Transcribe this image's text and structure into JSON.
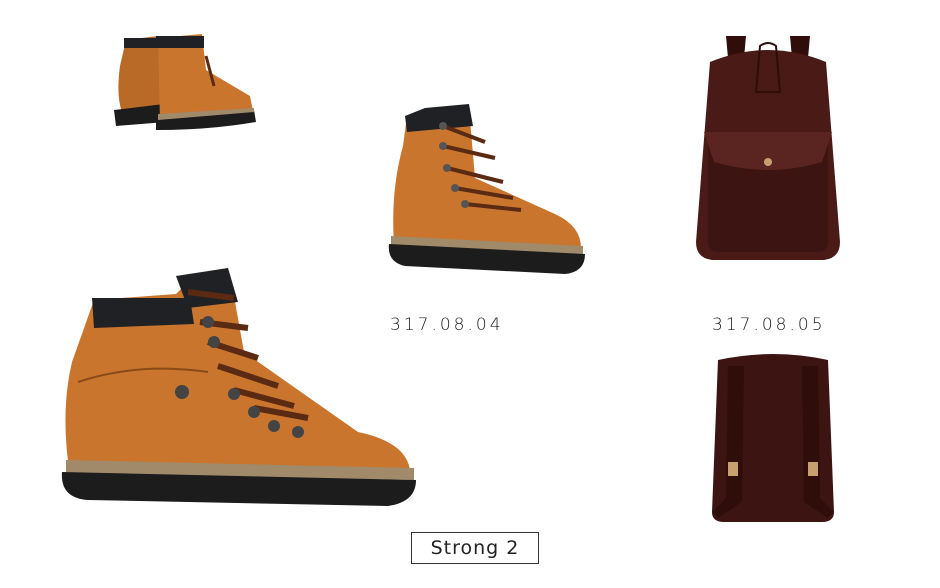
{
  "products": [
    {
      "code": "317.08.04"
    },
    {
      "code": "317.08.05"
    }
  ],
  "label": "Strong 2",
  "colors": {
    "boot_leather": "#C9752E",
    "boot_dark": "#8a4a17",
    "collar": "#1f2124",
    "sole": "#1c1c1c",
    "midsole": "#a08a6a",
    "lace": "#5a2a12",
    "bag": "#4a1a16",
    "bag_dark": "#2e0d0b"
  },
  "icons": [
    "boot-back-view",
    "boot-side-view",
    "boot-large-view",
    "backpack-front-view",
    "backpack-back-view"
  ]
}
